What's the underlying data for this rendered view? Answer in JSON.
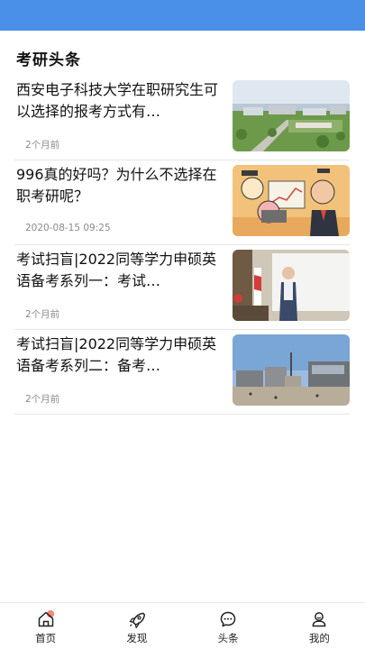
{
  "section": {
    "title": "考研头条"
  },
  "articles": [
    {
      "title": "西安电子科技大学在职研究生可以选择的报考方式有…",
      "meta": "2个月前",
      "thumb": "campus-aerial-photo"
    },
    {
      "title": "996真的好吗？为什么不选择在职考研呢？",
      "meta": "2020-08-15 09:25",
      "thumb": "cartoon-illustration"
    },
    {
      "title": "考试扫盲|2022同等学力申硕英语备考系列一：考试…",
      "meta": "2个月前",
      "thumb": "lecturer-photo"
    },
    {
      "title": "考试扫盲|2022同等学力申硕英语备考系列二：备考…",
      "meta": "2个月前",
      "thumb": "plaza-photo"
    }
  ],
  "tabbar": {
    "items": [
      {
        "label": "首页",
        "icon": "home-icon"
      },
      {
        "label": "发现",
        "icon": "rocket-icon"
      },
      {
        "label": "头条",
        "icon": "chat-icon"
      },
      {
        "label": "我的",
        "icon": "user-icon"
      }
    ]
  },
  "colors": {
    "status_bar": "#4a8fe8",
    "home_accent": "#f0745f"
  }
}
